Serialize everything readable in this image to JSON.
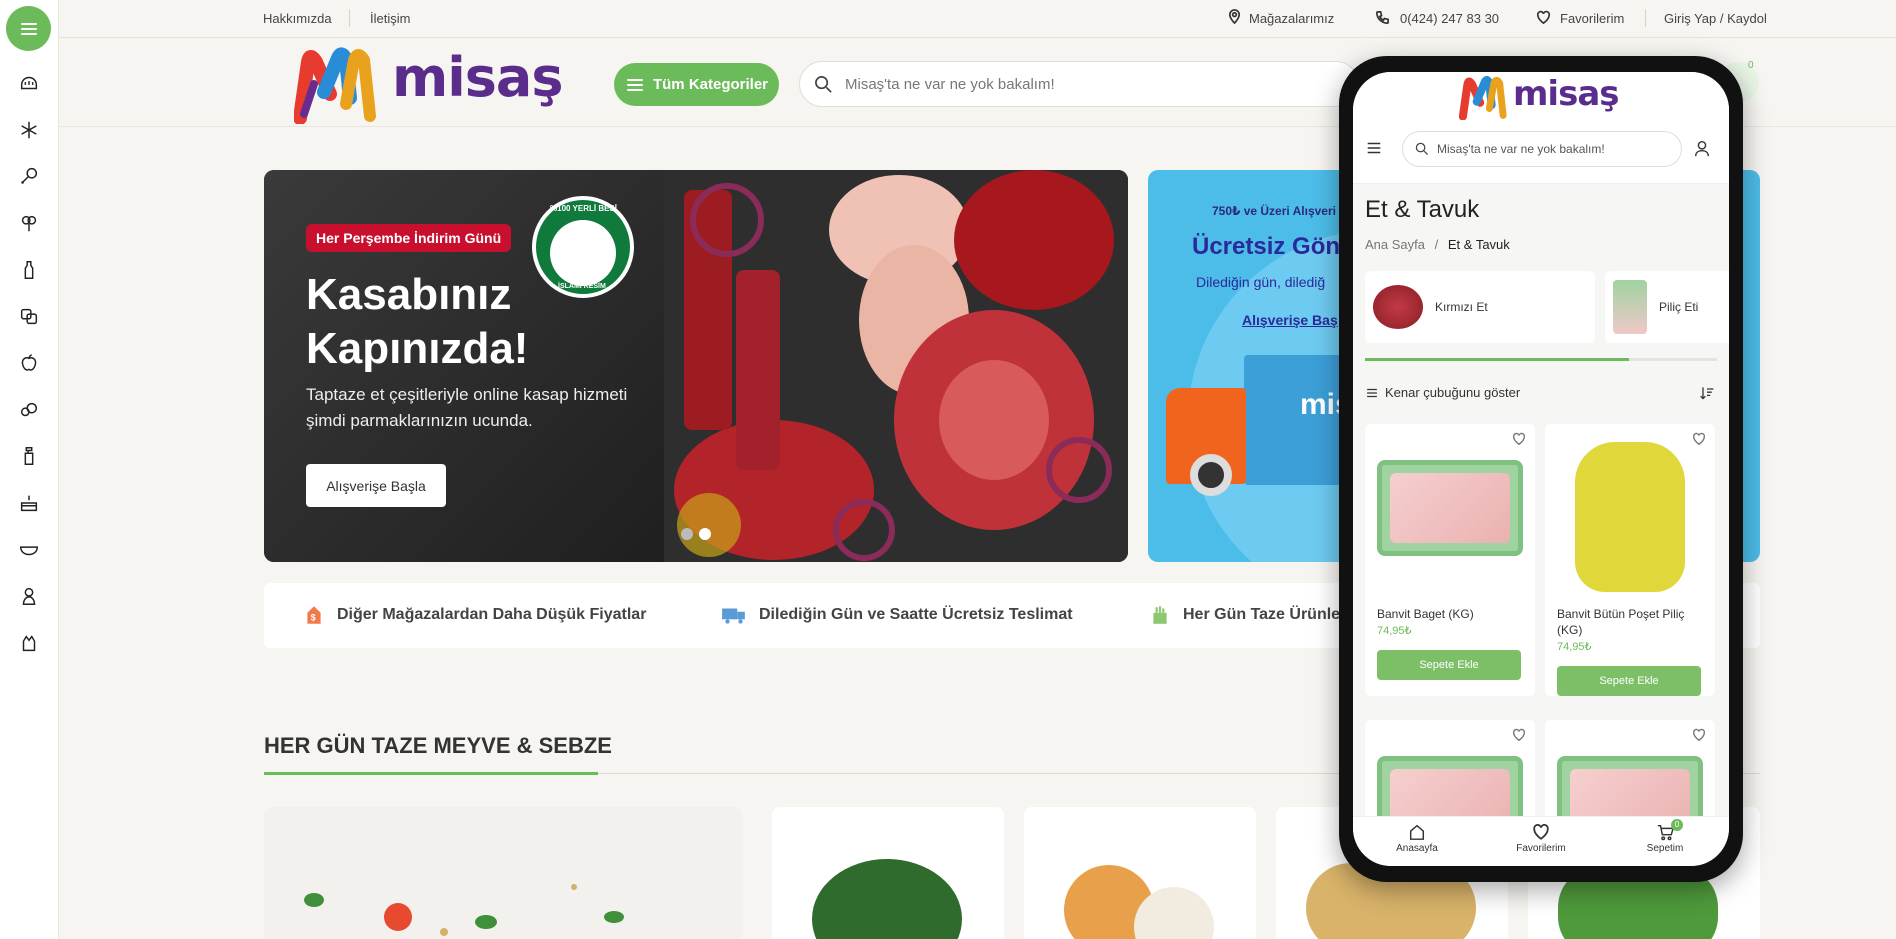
{
  "topbar": {
    "about": "Hakkımızda",
    "contact": "İletişim",
    "stores": "Mağazalarımız",
    "phone": "0(424) 247 83 30",
    "favorites": "Favorilerim",
    "login": "Giriş Yap / Kaydol"
  },
  "header": {
    "logo_text": "misaş",
    "categories_button": "Tüm Kategoriler",
    "search_placeholder": "Misaş'ta ne var ne yok bakalım!",
    "cart_count": "0"
  },
  "rail_icons": [
    "menu-icon",
    "bread-icon",
    "snowflake-icon",
    "meat-icon",
    "vegetables-icon",
    "bottle-icon",
    "cheese-icon",
    "apple-icon",
    "snacks-icon",
    "cleaning-icon",
    "cake-icon",
    "bowl-icon",
    "baby-icon",
    "pet-icon"
  ],
  "hero": {
    "badge": "Her Perşembe İndirim Günü",
    "title_line1": "Kasabınız",
    "title_line2": "Kapınızda!",
    "subtitle_line1": "Taptaze et çeşitleriyle online kasap hizmeti",
    "subtitle_line2": "şimdi parmaklarınızın ucunda.",
    "button": "Alışverişe Başla",
    "seal_top": "%100 YERLİ BESİ",
    "seal_bottom": "İSLAMİ KESİM"
  },
  "hero2": {
    "line1": "750₺ ve Üzeri Alışveri",
    "line2": "Ücretsiz Gönd",
    "line3": "Dilediğin gün, dilediğ",
    "link": "Alışverişe Baş",
    "truck_text": "mis"
  },
  "features": [
    {
      "label": "Diğer Mağazalardan Daha Düşük Fiyatlar",
      "icon": "price-tag-icon"
    },
    {
      "label": "Dilediğin Gün ve Saatte Ücretsiz Teslimat",
      "icon": "truck-icon"
    },
    {
      "label": "Her Gün Taze Ürünler",
      "icon": "fresh-icon"
    }
  ],
  "section": {
    "title": "HER GÜN TAZE MEYVE & SEBZE"
  },
  "phone": {
    "search_placeholder": "Misaş'ta ne var ne yok bakalım!",
    "page_title": "Et & Tavuk",
    "breadcrumb_home": "Ana Sayfa",
    "breadcrumb_sep": "/",
    "breadcrumb_current": "Et & Tavuk",
    "subcategories": [
      "Kırmızı Et",
      "Piliç Eti"
    ],
    "scroll_progress_fraction": 0.75,
    "sidebar_toggle": "Kenar çubuğunu göster",
    "products": [
      {
        "name": "Banvit Baget (KG)",
        "price": "74,95₺",
        "button": "Sepete Ekle"
      },
      {
        "name": "Banvit Bütün Poşet Piliç (KG)",
        "price": "74,95₺",
        "button": "Sepete Ekle"
      }
    ],
    "bottom_nav": [
      "Anasayfa",
      "Favorilerim",
      "Sepetim"
    ],
    "cart_count": "0"
  },
  "colors": {
    "brand_green": "#6cbb5a",
    "brand_purple": "#5a2d8c",
    "badge_red": "#c8102e",
    "hero2_blue": "#4cbde8"
  }
}
